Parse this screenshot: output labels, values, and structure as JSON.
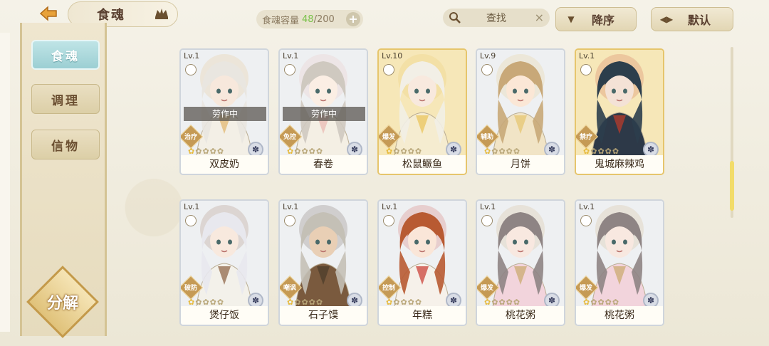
{
  "header": {
    "title": "食魂",
    "capacity_label": "食魂容量",
    "capacity_current": "48",
    "capacity_max": "/200",
    "capacity_add": "+",
    "search_label": "查找",
    "search_clear": "×",
    "sort_order_label": "降序",
    "sort_mode_label": "默认"
  },
  "sidebar": {
    "tabs": [
      {
        "label": "食魂",
        "active": true
      },
      {
        "label": "调理",
        "active": false
      },
      {
        "label": "信物",
        "active": false
      }
    ],
    "decompose_label": "分解"
  },
  "cards": [
    {
      "level": "Lv.1",
      "name": "双皮奶",
      "role": "治疗",
      "working": "劳作中",
      "stars": 1,
      "frame": "silver",
      "hair": "#e9e6e0",
      "skin": "#f7e8dc",
      "cloth": "#f3efe6",
      "accent": "#e1b56a"
    },
    {
      "level": "Lv.1",
      "name": "春卷",
      "role": "免控",
      "working": "劳作中",
      "stars": 1,
      "frame": "silver",
      "hair": "#cfc9c0",
      "skin": "#fbeee4",
      "cloth": "#f4efe4",
      "accent": "#e9b8b0"
    },
    {
      "level": "Lv.10",
      "name": "松鼠鳜鱼",
      "role": "爆发",
      "working": "",
      "stars": 1,
      "frame": "gold",
      "hair": "#f2efe6",
      "skin": "#f8e9de",
      "cloth": "#f5ecd0",
      "accent": "#e9c356"
    },
    {
      "level": "Lv.9",
      "name": "月饼",
      "role": "辅助",
      "working": "",
      "stars": 1,
      "frame": "silver",
      "hair": "#c8a878",
      "skin": "#fbe7d6",
      "cloth": "#f1e4c6",
      "accent": "#e6c46c"
    },
    {
      "level": "Lv.1",
      "name": "鬼城麻辣鸡",
      "role": "禁疗",
      "working": "",
      "stars": 1,
      "frame": "gold",
      "hair": "#2c3e4c",
      "skin": "#f4e2d6",
      "cloth": "#2d3948",
      "accent": "#c23a2a"
    },
    {
      "level": "Lv.1",
      "name": "煲仔饭",
      "role": "破防",
      "working": "",
      "stars": 1,
      "frame": "silver",
      "hair": "#e8e8ee",
      "skin": "#f8e9de",
      "cloth": "#f3f1ea",
      "accent": "#8a6040"
    },
    {
      "level": "Lv.1",
      "name": "石子馍",
      "role": "嘲讽",
      "working": "",
      "stars": 1,
      "frame": "silver",
      "hair": "#c4c0b6",
      "skin": "#e9cfb5",
      "cloth": "#7a5a3e",
      "accent": "#4a3a2a"
    },
    {
      "level": "Lv.1",
      "name": "年糕",
      "role": "控制",
      "working": "",
      "stars": 1,
      "frame": "silver",
      "hair": "#b85a32",
      "skin": "#fae6d8",
      "cloth": "#f6f1ea",
      "accent": "#c9382e"
    },
    {
      "level": "Lv.1",
      "name": "桃花粥",
      "role": "爆发",
      "working": "",
      "stars": 1,
      "frame": "silver",
      "hair": "#8e8484",
      "skin": "#f8e8e0",
      "cloth": "#f2d4dc",
      "accent": "#c9a86a"
    },
    {
      "level": "Lv.1",
      "name": "桃花粥",
      "role": "爆发",
      "working": "",
      "stars": 1,
      "frame": "silver",
      "hair": "#8e8484",
      "skin": "#f8e8e0",
      "cloth": "#f2d4dc",
      "accent": "#c9a86a"
    }
  ],
  "icons": {
    "back": "back-arrow-icon",
    "emblem": "crown-icon",
    "search": "magnifier-icon",
    "sort_order": "triangle-down-icon",
    "sort_mode": "filter-icon",
    "gem": "flower-gem-icon"
  }
}
